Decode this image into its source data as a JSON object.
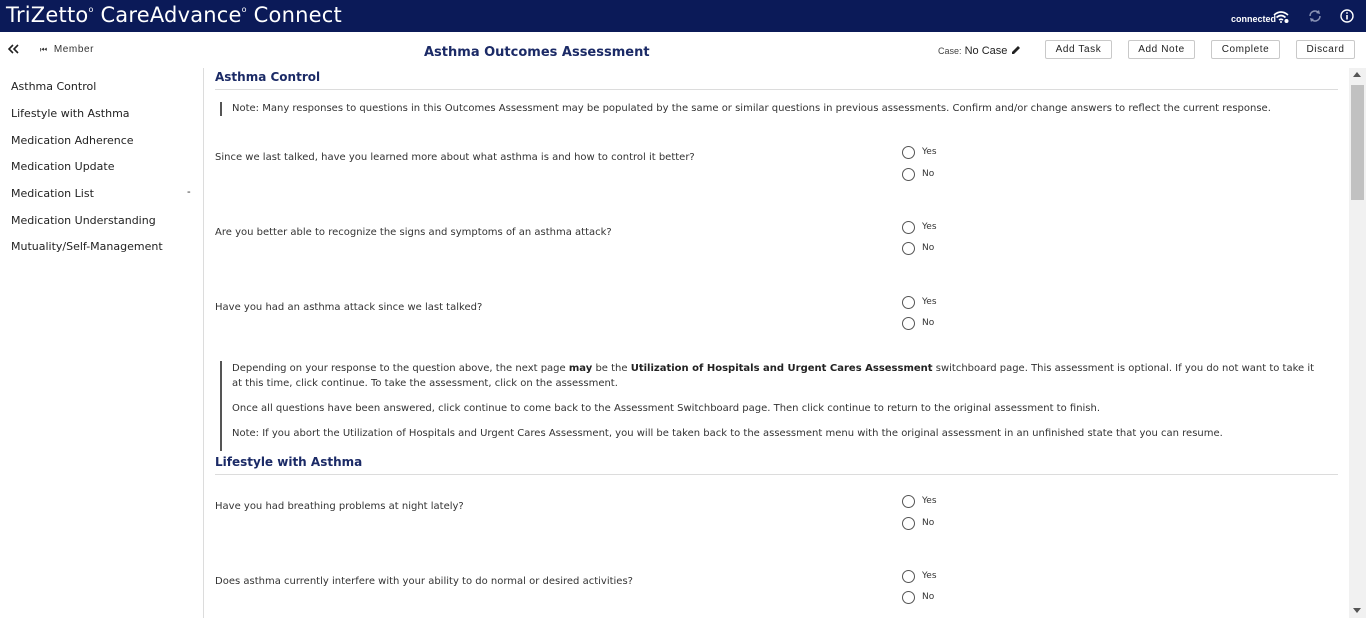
{
  "app": {
    "brand": "TriZetto",
    "product": "CareAdvance",
    "suffix": "Connect",
    "status": "connected",
    "wifi_icon": "wifi-icon",
    "sync_icon": "sync-icon",
    "info_icon": "info-icon",
    "header_color": "#0b1a58"
  },
  "subbar": {
    "collapse_icon": "double-chevron-left-icon",
    "member_label": "Member",
    "page_title": "Asthma Outcomes Assessment",
    "case_label": "Case:",
    "case_value": "No Case",
    "buttons": {
      "add_task": "Add Task",
      "add_note": "Add Note",
      "complete": "Complete",
      "discard": "Discard"
    }
  },
  "sidebar": {
    "items": [
      {
        "label": "Asthma Control"
      },
      {
        "label": "Lifestyle with Asthma"
      },
      {
        "label": "Medication Adherence"
      },
      {
        "label": "Medication Update"
      },
      {
        "label": "Medication List",
        "badge": "-"
      },
      {
        "label": "Medication Understanding"
      },
      {
        "label": "Mutuality/Self-Management"
      }
    ]
  },
  "sections": {
    "asthma_control": {
      "title": "Asthma Control",
      "note": "Note: Many responses to questions in this Outcomes Assessment may be populated by the same or similar questions in previous assessments. Confirm and/or change answers to reflect the current response.",
      "questions": [
        {
          "text": "Since we last talked, have you learned more about what asthma is and how to control it better?",
          "options": [
            "Yes",
            "No"
          ]
        },
        {
          "text": "Are you better able to recognize the signs and symptoms of an asthma attack?",
          "options": [
            "Yes",
            "No"
          ]
        },
        {
          "text": "Have you had an asthma attack since we last talked?",
          "options": [
            "Yes",
            "No"
          ]
        }
      ],
      "info": {
        "p1_a": "Depending on your response to the question above, the next page ",
        "p1_b": "may",
        "p1_c": " be the ",
        "p1_d": "Utilization of Hospitals and Urgent Cares Assessment",
        "p1_e": " switchboard page. This assessment is optional. If you do not want to take it at this time, click continue. To take the assessment, click on the assessment.",
        "p2": "Once all questions have been answered, click continue to come back to the Assessment Switchboard page. Then click continue to return to the original assessment to finish.",
        "p3": "Note: If you abort the Utilization of Hospitals and Urgent Cares Assessment, you will be taken back to the assessment menu with the original assessment in an unfinished state that you can resume."
      }
    },
    "lifestyle": {
      "title": "Lifestyle with Asthma",
      "questions": [
        {
          "text": "Have you had breathing problems at night lately?",
          "options": [
            "Yes",
            "No"
          ]
        },
        {
          "text": "Does asthma currently interfere with your ability to do normal or desired activities?",
          "options": [
            "Yes",
            "No"
          ]
        }
      ]
    }
  }
}
